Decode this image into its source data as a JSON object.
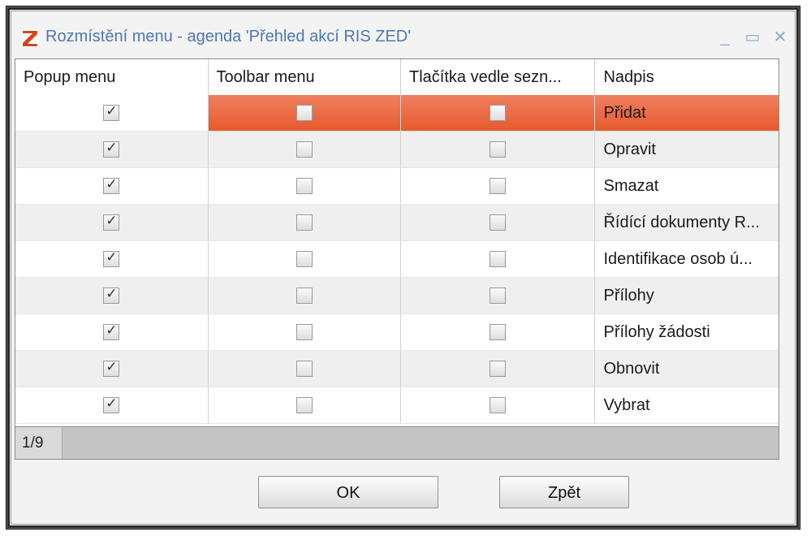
{
  "window": {
    "title": "Rozmístění menu - agenda 'Přehled akcí RIS ZED'"
  },
  "titlebar_buttons": {
    "minimize": "_",
    "maximize": "▭",
    "close": "✕"
  },
  "columns": [
    "Popup menu",
    "Toolbar menu",
    "Tlačítka vedle sezn...",
    "Nadpis"
  ],
  "rows": [
    {
      "popup": true,
      "toolbar": false,
      "beside": false,
      "label": "Přidat",
      "selected": true
    },
    {
      "popup": true,
      "toolbar": false,
      "beside": false,
      "label": "Opravit"
    },
    {
      "popup": true,
      "toolbar": false,
      "beside": false,
      "label": "Smazat"
    },
    {
      "popup": true,
      "toolbar": false,
      "beside": false,
      "label": "Řídící dokumenty R..."
    },
    {
      "popup": true,
      "toolbar": false,
      "beside": false,
      "label": "Identifikace osob ú..."
    },
    {
      "popup": true,
      "toolbar": false,
      "beside": false,
      "label": "Přílohy"
    },
    {
      "popup": true,
      "toolbar": false,
      "beside": false,
      "label": "Přílohy žádosti"
    },
    {
      "popup": true,
      "toolbar": false,
      "beside": false,
      "label": "Obnovit"
    },
    {
      "popup": true,
      "toolbar": false,
      "beside": false,
      "label": "Vybrat"
    }
  ],
  "status": {
    "pager": "1/9"
  },
  "buttons": {
    "ok": "OK",
    "back": "Zpět"
  },
  "colors": {
    "selection": "#e65a2c",
    "title": "#4d78b5"
  }
}
